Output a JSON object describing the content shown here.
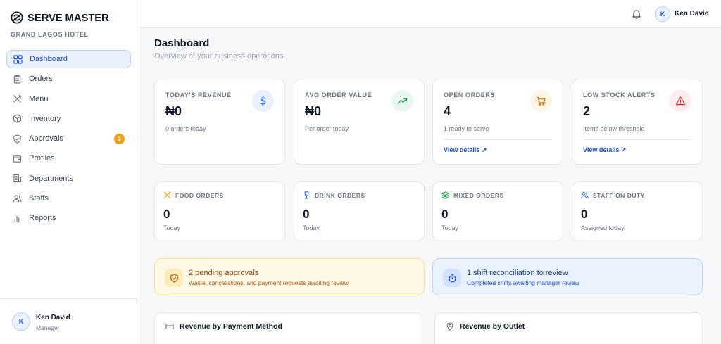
{
  "brand": {
    "name": "SERVE MASTER",
    "subtitle": "GRAND LAGOS HOTEL"
  },
  "sidebar": {
    "items": [
      {
        "label": "Dashboard",
        "icon": "dashboard-icon",
        "active": true
      },
      {
        "label": "Orders",
        "icon": "clipboard-icon"
      },
      {
        "label": "Menu",
        "icon": "utensils-icon"
      },
      {
        "label": "Inventory",
        "icon": "box-icon"
      },
      {
        "label": "Approvals",
        "icon": "shield-check-icon",
        "badge": "3"
      },
      {
        "label": "Profiles",
        "icon": "wallet-icon"
      },
      {
        "label": "Departments",
        "icon": "building-icon"
      },
      {
        "label": "Staffs",
        "icon": "users-icon"
      },
      {
        "label": "Reports",
        "icon": "bar-chart-icon"
      }
    ],
    "user": {
      "initial": "K",
      "name": "Ken David",
      "role": "Manager"
    }
  },
  "topbar": {
    "user_initial": "K",
    "user_name": "Ken David"
  },
  "page": {
    "title": "Dashboard",
    "subtitle": "Overview of your business operations"
  },
  "stats": [
    {
      "label": "TODAY'S REVENUE",
      "value": "₦0",
      "note": "0 orders today",
      "icon": "dollar-icon",
      "color": "#2563eb",
      "bg": "#eaf1fd"
    },
    {
      "label": "AVG ORDER VALUE",
      "value": "₦0",
      "note": "Per order today",
      "icon": "trending-up-icon",
      "color": "#16a34a",
      "bg": "#e9f8ee"
    },
    {
      "label": "OPEN ORDERS",
      "value": "4",
      "note": "1 ready to serve",
      "icon": "cart-icon",
      "color": "#d97706",
      "bg": "#fef6e4",
      "link": "View details ↗"
    },
    {
      "label": "LOW STOCK ALERTS",
      "value": "2",
      "note": "Items below threshold",
      "icon": "alert-triangle-icon",
      "color": "#dc2626",
      "bg": "#fdeced",
      "link": "View details ↗"
    }
  ],
  "mini_stats": [
    {
      "label": "FOOD ORDERS",
      "value": "0",
      "note": "Today",
      "icon": "utensils-icon",
      "color": "#f59e0b"
    },
    {
      "label": "DRINK ORDERS",
      "value": "0",
      "note": "Today",
      "icon": "wine-icon",
      "color": "#2563eb"
    },
    {
      "label": "MIXED ORDERS",
      "value": "0",
      "note": "Today",
      "icon": "layers-icon",
      "color": "#16a34a"
    },
    {
      "label": "STAFF ON DUTY",
      "value": "0",
      "note": "Assigned today",
      "icon": "users-icon",
      "color": "#2563eb"
    }
  ],
  "alerts": {
    "approvals": {
      "title": "2 pending approvals",
      "desc": "Waste, cancellations, and payment requests awaiting review"
    },
    "shift": {
      "title": "1 shift reconciliation to review",
      "desc": "Completed shifts awaiting manager review"
    }
  },
  "panels": {
    "payment": "Revenue by Payment Method",
    "outlet": "Revenue by Outlet"
  },
  "colors": {
    "accent": "#1d4ed8",
    "warning": "#f59e0b",
    "danger": "#dc2626",
    "success": "#16a34a"
  }
}
